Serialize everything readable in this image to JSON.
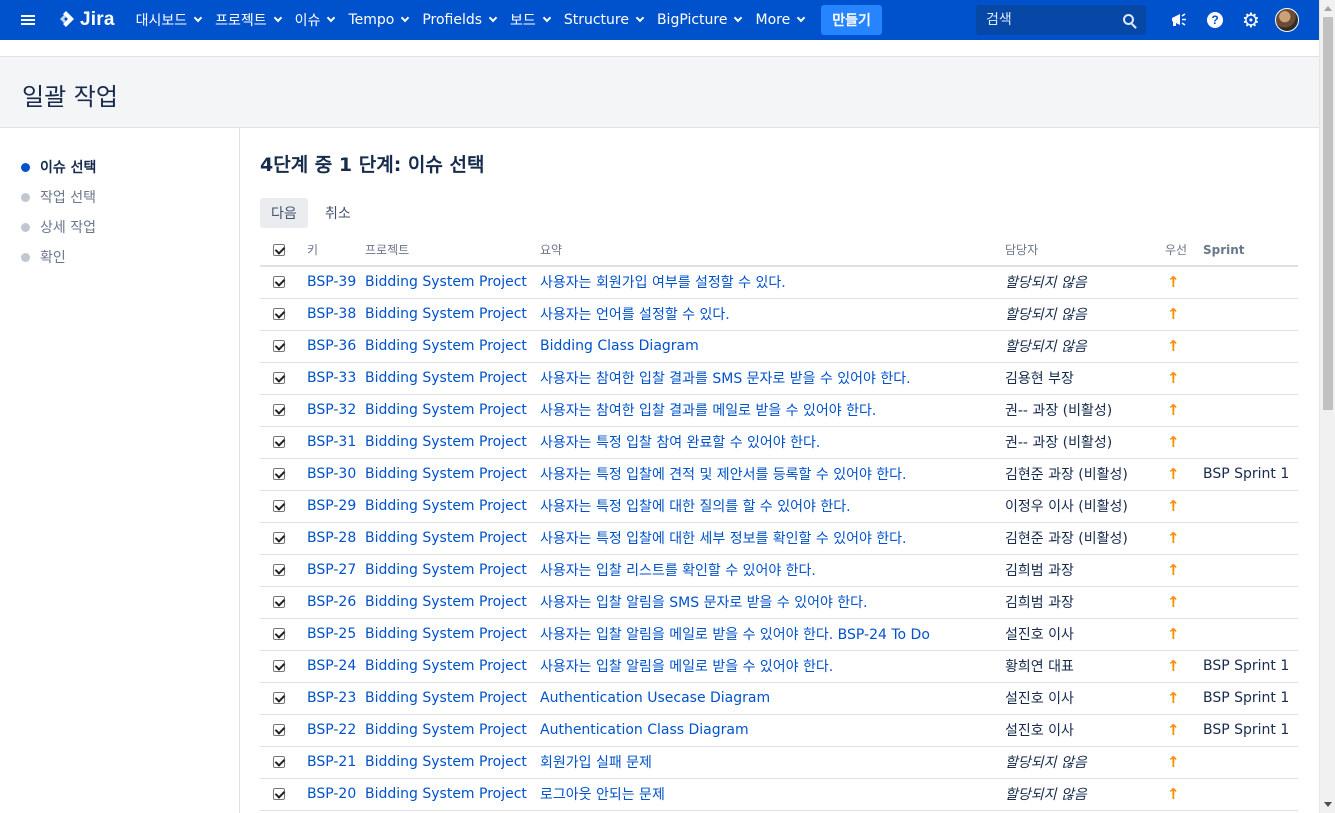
{
  "nav": {
    "logo": "Jira",
    "items": [
      "대시보드",
      "프로젝트",
      "이슈",
      "Tempo",
      "Profields",
      "보드",
      "Structure",
      "BigPicture",
      "More"
    ],
    "create_label": "만들기",
    "search_placeholder": "검색"
  },
  "page": {
    "title": "일괄 작업"
  },
  "sidebar": {
    "steps": [
      "이슈 선택",
      "작업 선택",
      "상세 작업",
      "확인"
    ],
    "active_index": 0
  },
  "main": {
    "heading_step_total": "4",
    "heading_mid": "단계 중 ",
    "heading_step_current": "1",
    "heading_tail": " 단계: 이슈 선택",
    "next_label": "다음",
    "cancel_label": "취소"
  },
  "table": {
    "columns": [
      "",
      "키",
      "프로젝트",
      "요약",
      "담당자",
      "우선",
      "Sprint"
    ],
    "rows": [
      {
        "checked": true,
        "key": "BSP-39",
        "project": "Bidding System Project",
        "summary": "사용자는 회원가입 여부를 설정할 수 있다.",
        "assignee": "할당되지 않음",
        "unassigned": true,
        "priority": "↑",
        "sprint": ""
      },
      {
        "checked": true,
        "key": "BSP-38",
        "project": "Bidding System Project",
        "summary": "사용자는 언어를 설정할 수 있다.",
        "assignee": "할당되지 않음",
        "unassigned": true,
        "priority": "↑",
        "sprint": ""
      },
      {
        "checked": true,
        "key": "BSP-36",
        "project": "Bidding System Project",
        "summary": "Bidding Class Diagram",
        "assignee": "할당되지 않음",
        "unassigned": true,
        "priority": "↑",
        "sprint": ""
      },
      {
        "checked": true,
        "key": "BSP-33",
        "project": "Bidding System Project",
        "summary": "사용자는 참여한 입찰 결과를 SMS 문자로 받을 수 있어야 한다.",
        "assignee": "김용현 부장",
        "unassigned": false,
        "priority": "↑",
        "sprint": ""
      },
      {
        "checked": true,
        "key": "BSP-32",
        "project": "Bidding System Project",
        "summary": "사용자는 참여한 입찰 결과를 메일로 받을 수 있어야 한다.",
        "assignee": "권-- 과장 (비활성)",
        "unassigned": false,
        "priority": "↑",
        "sprint": ""
      },
      {
        "checked": true,
        "key": "BSP-31",
        "project": "Bidding System Project",
        "summary": "사용자는 특정 입찰 참여 완료할 수 있어야 한다.",
        "assignee": "권-- 과장 (비활성)",
        "unassigned": false,
        "priority": "↑",
        "sprint": ""
      },
      {
        "checked": true,
        "key": "BSP-30",
        "project": "Bidding System Project",
        "summary": "사용자는 특정 입찰에 견적 및 제안서를 등록할 수 있어야 한다.",
        "assignee": "김현준 과장 (비활성)",
        "unassigned": false,
        "priority": "↑",
        "sprint": "BSP Sprint 1"
      },
      {
        "checked": true,
        "key": "BSP-29",
        "project": "Bidding System Project",
        "summary": "사용자는 특정 입찰에 대한 질의를 할 수 있어야 한다.",
        "assignee": "이정우 이사 (비활성)",
        "unassigned": false,
        "priority": "↑",
        "sprint": ""
      },
      {
        "checked": true,
        "key": "BSP-28",
        "project": "Bidding System Project",
        "summary": "사용자는 특정 입찰에 대한 세부 정보를 확인할 수 있어야 한다.",
        "assignee": "김현준 과장 (비활성)",
        "unassigned": false,
        "priority": "↑",
        "sprint": ""
      },
      {
        "checked": true,
        "key": "BSP-27",
        "project": "Bidding System Project",
        "summary": "사용자는 입찰 리스트를 확인할 수 있어야 한다.",
        "assignee": "김희범 과장",
        "unassigned": false,
        "priority": "↑",
        "sprint": ""
      },
      {
        "checked": true,
        "key": "BSP-26",
        "project": "Bidding System Project",
        "summary": "사용자는 입찰 알림을 SMS 문자로 받을 수 있어야 한다.",
        "assignee": "김희범 과장",
        "unassigned": false,
        "priority": "↑",
        "sprint": ""
      },
      {
        "checked": true,
        "key": "BSP-25",
        "project": "Bidding System Project",
        "summary": "사용자는 입찰 알림을 메일로 받을 수 있어야 한다. BSP-24 To Do",
        "assignee": "설진호 이사",
        "unassigned": false,
        "priority": "↑",
        "sprint": ""
      },
      {
        "checked": true,
        "key": "BSP-24",
        "project": "Bidding System Project",
        "summary": "사용자는 입찰 알림을 메일로 받을 수 있어야 한다.",
        "assignee": "황희연 대표",
        "unassigned": false,
        "priority": "↑",
        "sprint": "BSP Sprint 1"
      },
      {
        "checked": true,
        "key": "BSP-23",
        "project": "Bidding System Project",
        "summary": "Authentication Usecase Diagram",
        "assignee": "설진호 이사",
        "unassigned": false,
        "priority": "↑",
        "sprint": "BSP Sprint 1"
      },
      {
        "checked": true,
        "key": "BSP-22",
        "project": "Bidding System Project",
        "summary": "Authentication Class Diagram",
        "assignee": "설진호 이사",
        "unassigned": false,
        "priority": "↑",
        "sprint": "BSP Sprint 1"
      },
      {
        "checked": true,
        "key": "BSP-21",
        "project": "Bidding System Project",
        "summary": "회원가입 실패 문제",
        "assignee": "할당되지 않음",
        "unassigned": true,
        "priority": "↑",
        "sprint": ""
      },
      {
        "checked": true,
        "key": "BSP-20",
        "project": "Bidding System Project",
        "summary": "로그아웃 안되는 문제",
        "assignee": "할당되지 않음",
        "unassigned": true,
        "priority": "↑",
        "sprint": ""
      }
    ]
  }
}
